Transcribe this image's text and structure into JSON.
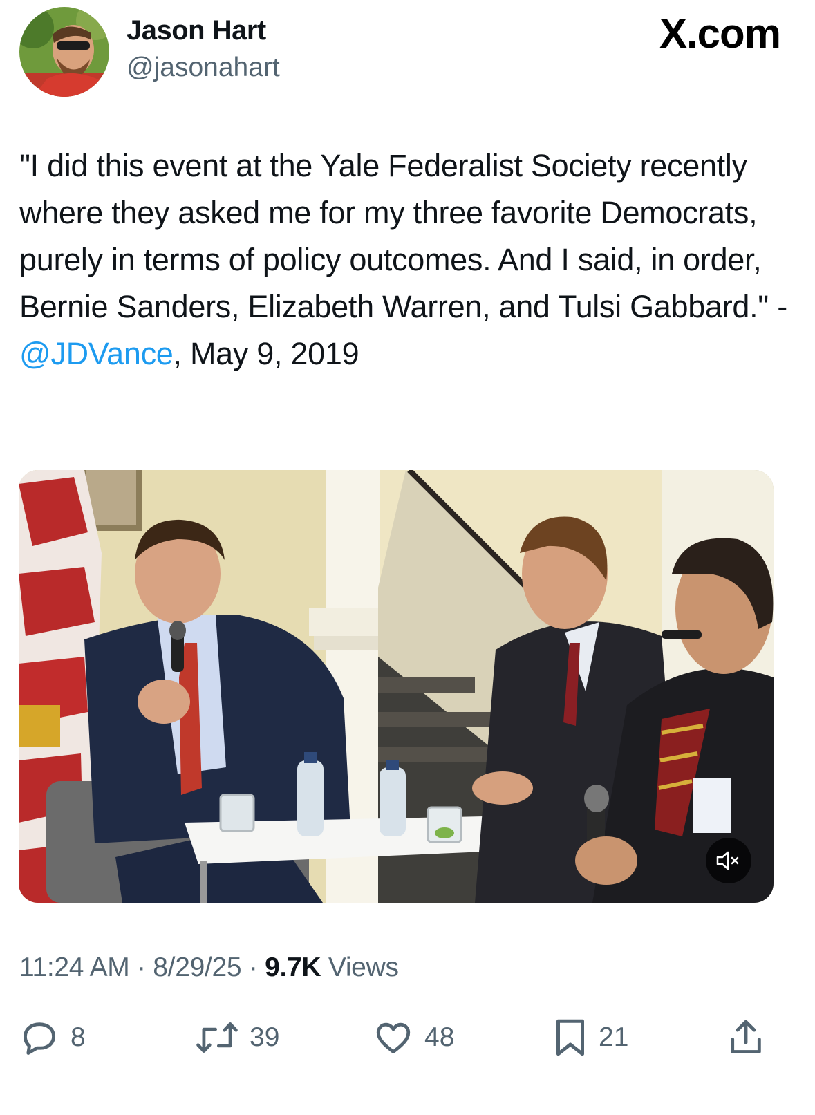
{
  "author": {
    "display_name": "Jason Hart",
    "handle": "@jasonahart",
    "avatar_icon": "user-avatar-photo"
  },
  "site_label": "X.com",
  "tweet": {
    "text_before_mention": "\"I did this event at the Yale Federalist Society recently where they asked me for my three favorite Democrats, purely in terms of policy outcomes. And I said, in order, Bernie Sanders, Elizabeth Warren, and Tulsi Gabbard.\" -",
    "mention": "@JDVance",
    "text_after_mention": ", May 9, 2019"
  },
  "media": {
    "type": "video",
    "mute_icon": "speaker-muted-icon"
  },
  "meta": {
    "time": "11:24 AM",
    "separator": "·",
    "date": "8/29/25",
    "views_count": "9.7K",
    "views_label": "Views"
  },
  "actions": {
    "replies": {
      "icon": "reply-icon",
      "count": "8"
    },
    "reposts": {
      "icon": "repost-icon",
      "count": "39"
    },
    "likes": {
      "icon": "heart-icon",
      "count": "48"
    },
    "bookmarks": {
      "icon": "bookmark-icon",
      "count": "21"
    },
    "share": {
      "icon": "share-icon"
    }
  },
  "colors": {
    "text": "#0f1419",
    "secondary": "#536471",
    "link": "#1d9bf0"
  }
}
